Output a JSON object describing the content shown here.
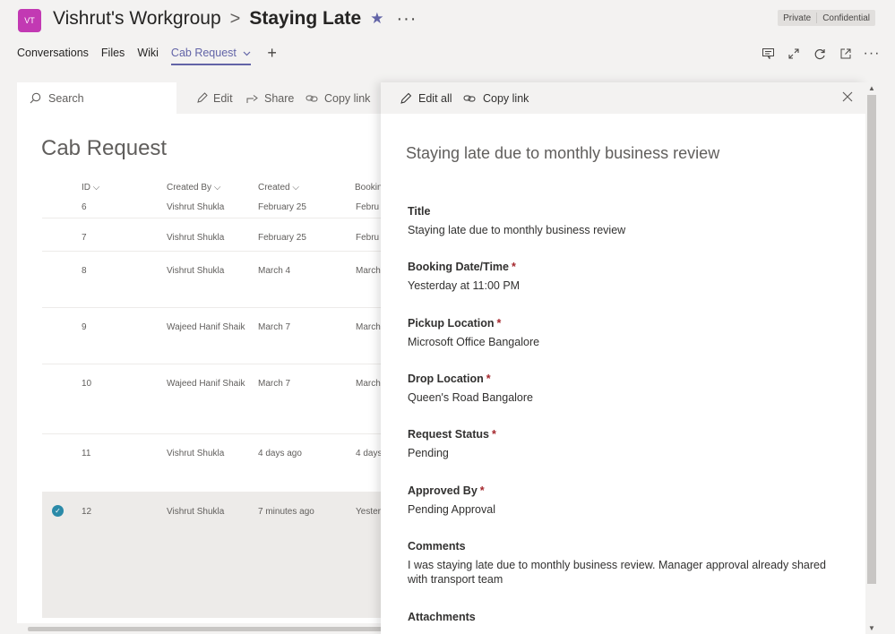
{
  "header": {
    "avatar": "VT",
    "team": "Vishrut's Workgroup",
    "separator": ">",
    "channel": "Staying Late",
    "sensitivity": [
      "Private",
      "Confidential"
    ]
  },
  "tabs": [
    {
      "label": "Conversations"
    },
    {
      "label": "Files"
    },
    {
      "label": "Wiki"
    },
    {
      "label": "Cab Request"
    }
  ],
  "list": {
    "search_placeholder": "Search",
    "commands": [
      "Edit",
      "Share",
      "Copy link"
    ],
    "title": "Cab Request",
    "columns": [
      "ID",
      "Created By",
      "Created",
      "Bookin"
    ],
    "rows": [
      {
        "id": "6",
        "by": "Vishrut Shukla",
        "created": "February 25",
        "booking": "Febru"
      },
      {
        "id": "7",
        "by": "Vishrut Shukla",
        "created": "February 25",
        "booking": "Febru"
      },
      {
        "id": "8",
        "by": "Vishrut Shukla",
        "created": "March 4",
        "booking": "March"
      },
      {
        "id": "9",
        "by": "Wajeed Hanif Shaik",
        "created": "March 7",
        "booking": "March"
      },
      {
        "id": "10",
        "by": "Wajeed Hanif Shaik",
        "created": "March 7",
        "booking": "March"
      },
      {
        "id": "11",
        "by": "Vishrut Shukla",
        "created": "4 days ago",
        "booking": "4 days"
      },
      {
        "id": "12",
        "by": "Vishrut Shukla",
        "created": "7 minutes ago",
        "booking": "Yester"
      }
    ]
  },
  "panel": {
    "edit_all": "Edit all",
    "copy_link": "Copy link",
    "item_title": "Staying late due to monthly business review",
    "required_mark": "*",
    "fields": [
      {
        "label": "Title",
        "value": "Staying late due to monthly business review"
      },
      {
        "label": "Booking Date/Time",
        "value": "Yesterday at 11:00 PM"
      },
      {
        "label": "Pickup Location",
        "value": "Microsoft Office Bangalore"
      },
      {
        "label": "Drop Location",
        "value": "Queen's Road Bangalore"
      },
      {
        "label": "Request Status",
        "value": "Pending"
      },
      {
        "label": "Approved By",
        "value": "Pending Approval"
      },
      {
        "label": "Comments",
        "value": "I was staying late due to monthly business review. Manager approval already shared with transport team"
      },
      {
        "label": "Attachments",
        "value": ""
      }
    ]
  }
}
